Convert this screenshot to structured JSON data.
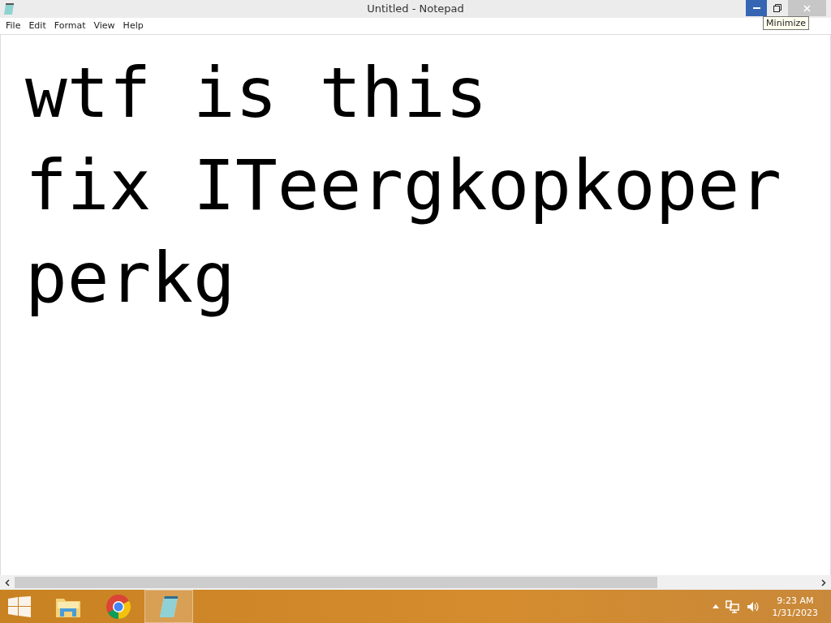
{
  "window": {
    "title": "Untitled - Notepad",
    "controls": [
      {
        "kind": "minimize",
        "hovered": true
      },
      {
        "kind": "restore",
        "hovered": false
      },
      {
        "kind": "close",
        "hovered": false
      }
    ]
  },
  "tooltip": "Minimize",
  "menu": [
    "File",
    "Edit",
    "Format",
    "View",
    "Help"
  ],
  "document": {
    "lines": [
      "wtf is this",
      "fix ITeergkopkoper",
      "perkg"
    ]
  },
  "taskbar": {
    "apps": [
      {
        "kind": "explorer",
        "selected": false
      },
      {
        "kind": "chrome",
        "selected": false
      },
      {
        "kind": "notepad",
        "selected": true
      }
    ],
    "time": "9:23 AM",
    "date": "1/31/2023"
  }
}
